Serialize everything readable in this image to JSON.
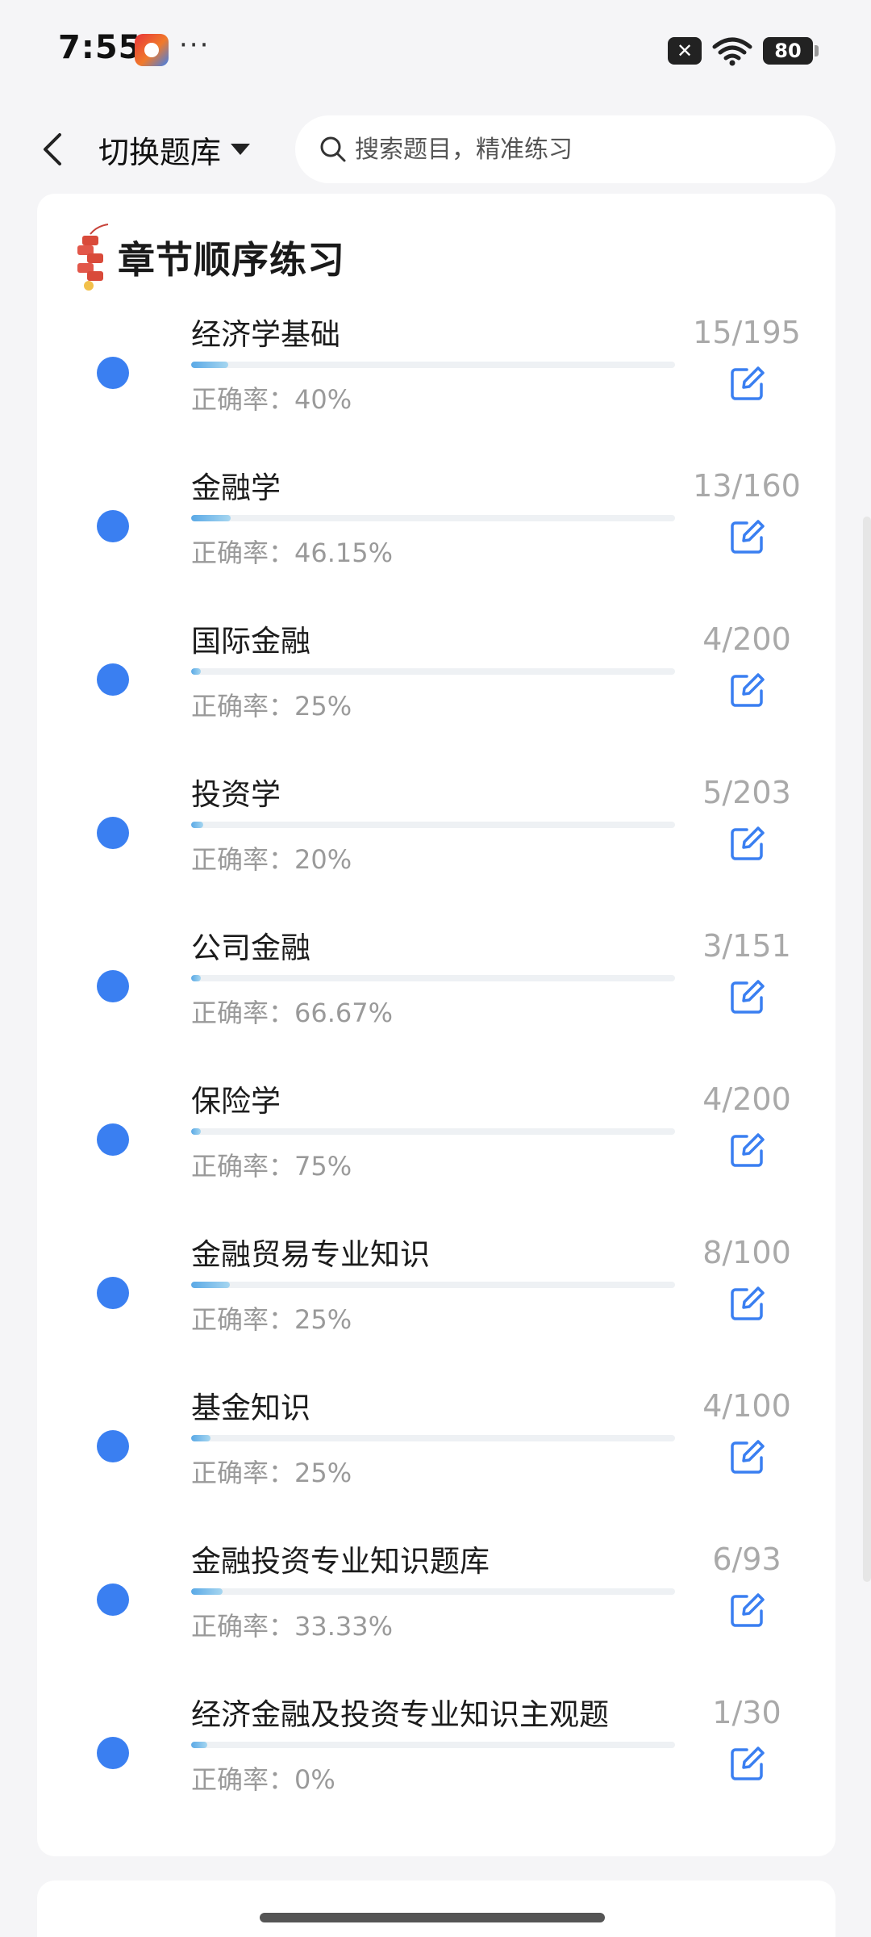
{
  "status_bar": {
    "time": "7:55",
    "more": "···",
    "x_badge": "✕",
    "battery": "80",
    "icons": [
      "app-notification-icon",
      "close-badge-icon",
      "wifi-icon",
      "battery-icon"
    ]
  },
  "header": {
    "back_icon": "chevron-left-icon",
    "switch_label": "切换题库",
    "switch_caret_icon": "caret-down-icon",
    "search_icon": "search-icon",
    "search_placeholder": "搜索题目，精准练习"
  },
  "card": {
    "icon": "firecracker-icon",
    "title": "章节顺序练习"
  },
  "chapters": [
    {
      "name": "经济学基础",
      "accuracy": "正确率：40%",
      "count": "15/195",
      "progress": 0.077
    },
    {
      "name": "金融学",
      "accuracy": "正确率：46.15%",
      "count": "13/160",
      "progress": 0.081
    },
    {
      "name": "国际金融",
      "accuracy": "正确率：25%",
      "count": "4/200",
      "progress": 0.02
    },
    {
      "name": "投资学",
      "accuracy": "正确率：20%",
      "count": "5/203",
      "progress": 0.025
    },
    {
      "name": "公司金融",
      "accuracy": "正确率：66.67%",
      "count": "3/151",
      "progress": 0.02
    },
    {
      "name": "保险学",
      "accuracy": "正确率：75%",
      "count": "4/200",
      "progress": 0.02
    },
    {
      "name": "金融贸易专业知识",
      "accuracy": "正确率：25%",
      "count": "8/100",
      "progress": 0.08
    },
    {
      "name": "基金知识",
      "accuracy": "正确率：25%",
      "count": "4/100",
      "progress": 0.04
    },
    {
      "name": "金融投资专业知识题库",
      "accuracy": "正确率：33.33%",
      "count": "6/93",
      "progress": 0.065
    },
    {
      "name": "经济金融及投资专业知识主观题",
      "accuracy": "正确率：0%",
      "count": "1/30",
      "progress": 0.033
    }
  ],
  "colors": {
    "accent": "#3a7ff1",
    "progress_fill": "#5aa9e6",
    "muted_text": "#9a9a9a",
    "background": "#f5f5f7"
  }
}
